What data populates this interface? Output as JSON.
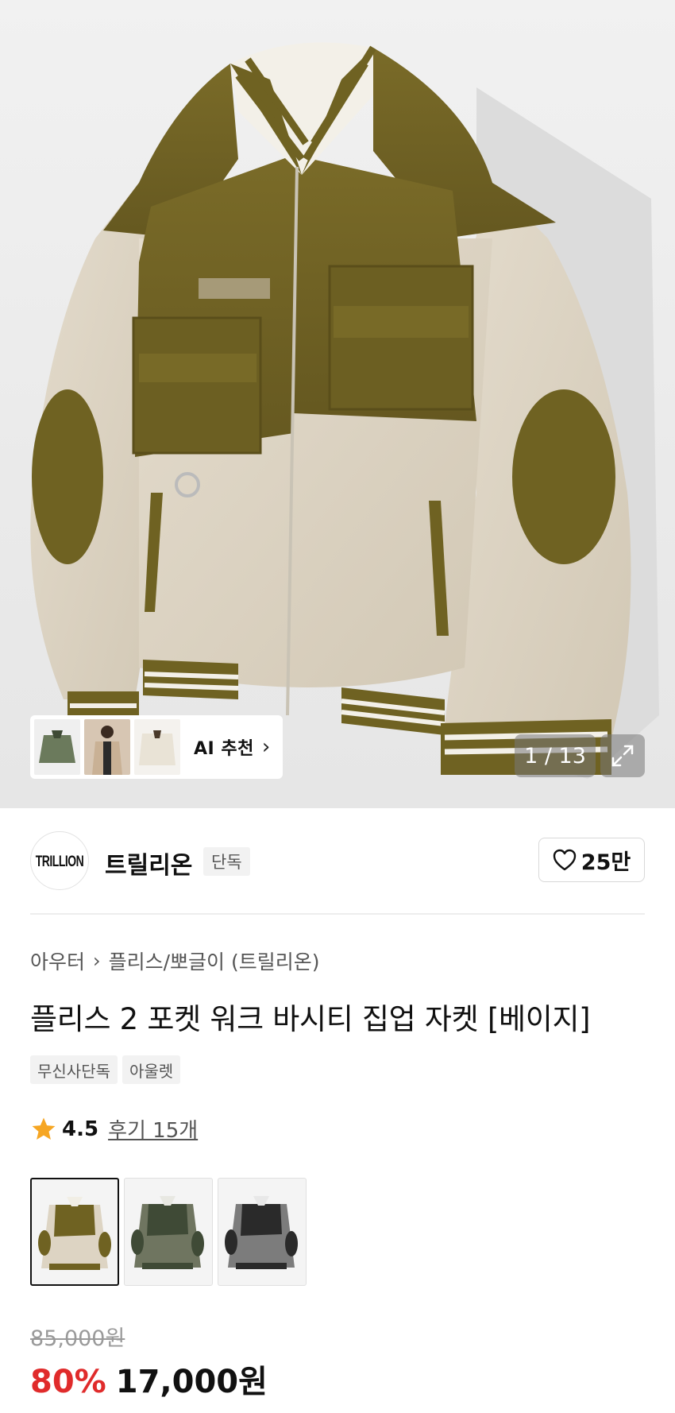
{
  "gallery": {
    "counter": "1 / 13",
    "ai_label": "AI 추천",
    "ai_thumbs": [
      "green-jacket-thumb",
      "model-thumb",
      "ivory-jacket-thumb"
    ]
  },
  "brand": {
    "logo_text": "TRILLION",
    "name": "트릴리온",
    "badge": "단독",
    "likes": "25만"
  },
  "breadcrumb": [
    "아우터",
    "플리스/뽀글이 (트릴리온)"
  ],
  "product": {
    "title": "플리스 2 포켓 워크 바시티 집업 자켓 [베이지]",
    "tags": [
      "무신사단독",
      "아울렛"
    ]
  },
  "rating": {
    "score": "4.5",
    "reviews": "후기 15개"
  },
  "swatches": [
    {
      "name": "beige",
      "selected": true
    },
    {
      "name": "khaki",
      "selected": false
    },
    {
      "name": "charcoal",
      "selected": false
    }
  ],
  "price": {
    "original": "85,000원",
    "discount": "80%",
    "final": "17,000원"
  },
  "colors": {
    "discount_red": "#e02b2b",
    "olive": "#6f6222",
    "fleece": "#ddd4c3",
    "star": "#f6a623"
  },
  "icons": [
    "chevron-right-icon",
    "expand-icon",
    "heart-icon",
    "star-icon"
  ]
}
